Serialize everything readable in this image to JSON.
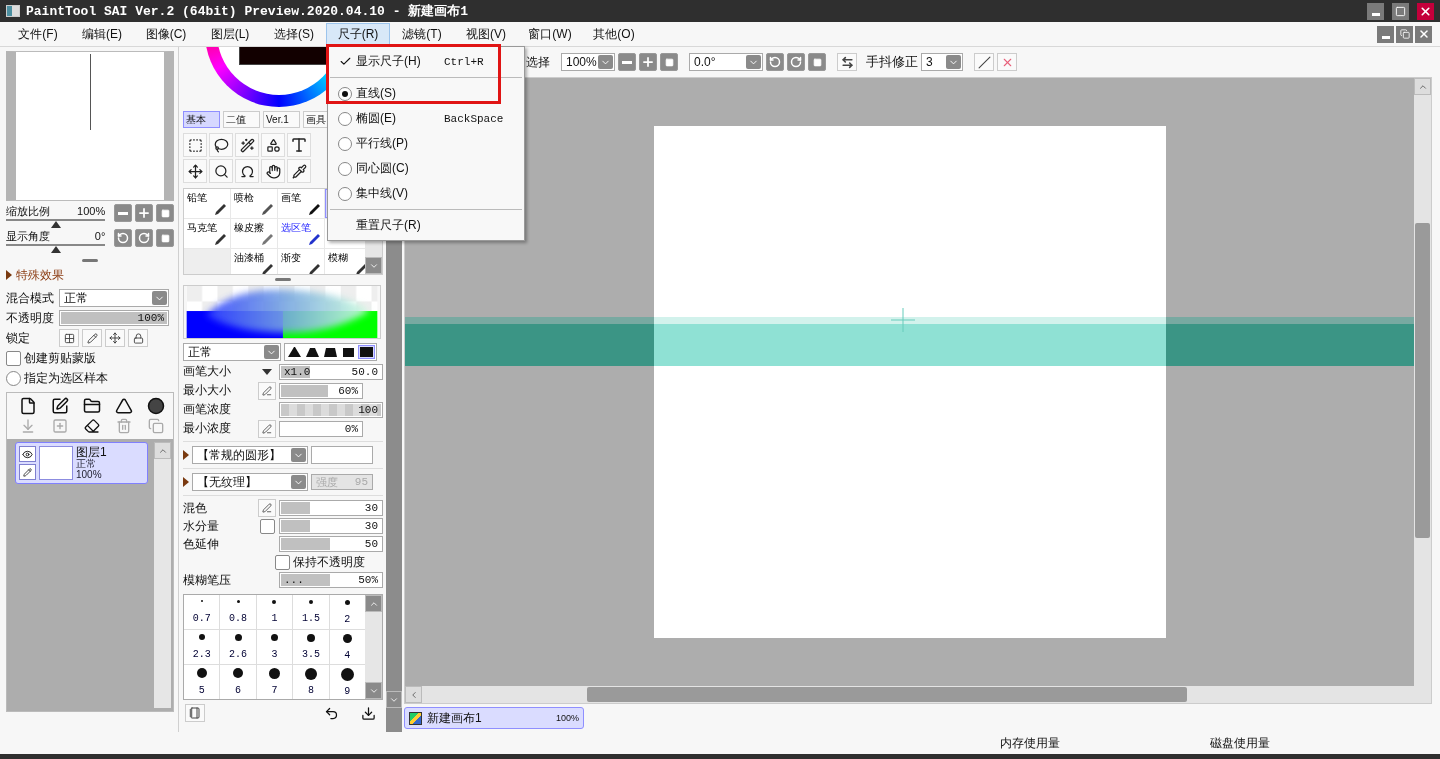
{
  "window": {
    "title": "PaintTool SAI Ver.2 (64bit) Preview.2020.04.10 - 新建画布1"
  },
  "menu": [
    {
      "label": "文件(F)",
      "selected": false
    },
    {
      "label": "编辑(E)",
      "selected": false
    },
    {
      "label": "图像(C)",
      "selected": false
    },
    {
      "label": "图层(L)",
      "selected": false
    },
    {
      "label": "选择(S)",
      "selected": false
    },
    {
      "label": "尺子(R)",
      "selected": true
    },
    {
      "label": "滤镜(T)",
      "selected": false
    },
    {
      "label": "视图(V)",
      "selected": false
    },
    {
      "label": "窗口(W)",
      "selected": false
    },
    {
      "label": "其他(O)",
      "selected": false
    }
  ],
  "ruler_menu": [
    {
      "kind": "check",
      "label": "显示尺子(H)",
      "shortcut": "Ctrl+R",
      "checked": true
    },
    {
      "kind": "separator"
    },
    {
      "kind": "radio",
      "label": "直线(S)",
      "selected": true
    },
    {
      "kind": "radio",
      "label": "椭圆(E)",
      "shortcut": "BackSpace",
      "selected": false
    },
    {
      "kind": "radio",
      "label": "平行线(P)",
      "selected": false
    },
    {
      "kind": "radio",
      "label": "同心圆(C)",
      "selected": false
    },
    {
      "kind": "radio",
      "label": "集中线(V)",
      "selected": false
    },
    {
      "kind": "separator"
    },
    {
      "kind": "command",
      "label": "重置尺子(R)"
    }
  ],
  "navigator": {
    "zoom": {
      "label": "缩放比例",
      "value": "100%",
      "level": 0.5
    },
    "angle": {
      "label": "显示角度",
      "value": "0°",
      "level": 0.5
    }
  },
  "effects": {
    "title": "特殊效果",
    "expanded": false
  },
  "layer_props": {
    "blend": {
      "label": "混合模式",
      "value": "正常"
    },
    "opacity": {
      "label": "不透明度",
      "value": "100%",
      "level": 1
    },
    "lock_label": "锁定",
    "clipping": {
      "label": "创建剪贴蒙版",
      "checked": false
    },
    "selection_source": {
      "label": "指定为选区样本",
      "selected": false
    }
  },
  "layers": [
    {
      "name": "图层1",
      "mode": "正常",
      "opacity": "100%",
      "selected": true
    }
  ],
  "color_tabs": [
    {
      "label": "基本",
      "selected": true
    },
    {
      "label": "二值",
      "selected": false
    },
    {
      "label": "Ver.1",
      "selected": false
    },
    {
      "label": "画具",
      "selected": false
    }
  ],
  "brush_tools": [
    {
      "kind": "tool",
      "label": "铅笔",
      "selected": false
    },
    {
      "kind": "tool",
      "label": "喷枪",
      "selected": false
    },
    {
      "kind": "tool",
      "label": "画笔",
      "selected": false
    },
    {
      "kind": "tool",
      "selected": true
    },
    {
      "kind": "tool",
      "label": "马克笔",
      "selected": false
    },
    {
      "kind": "tool",
      "label": "橡皮擦",
      "selected": false
    },
    {
      "kind": "selection_tool",
      "label": "选区笔",
      "selected": false
    },
    {
      "kind": "selection_tool",
      "selected": false
    },
    {
      "kind": "empty"
    },
    {
      "kind": "tool",
      "label": "油漆桶",
      "selected": false
    },
    {
      "kind": "tool",
      "label": "渐变",
      "selected": false
    },
    {
      "kind": "tool",
      "label": "模糊",
      "selected": false
    }
  ],
  "brush": {
    "blend": "正常",
    "shapes": [
      {
        "selected": false
      },
      {
        "selected": false
      },
      {
        "selected": false
      },
      {
        "selected": false
      },
      {
        "selected": true
      }
    ],
    "params": [
      {
        "label": "画笔大小",
        "prefix": "x1.0",
        "value": "50.0",
        "level": 0.3,
        "kind": "size"
      },
      {
        "label": "最小大小",
        "value": "60%",
        "level": 0.6,
        "kind": "pressure"
      },
      {
        "label": "画笔浓度",
        "value": "100",
        "level": 1,
        "kind": "density"
      },
      {
        "label": "最小浓度",
        "value": "0%",
        "kind": "pressure"
      }
    ],
    "shape": "【常规的圆形】",
    "texture": "【无纹理】",
    "texture_strength": {
      "label": "强度",
      "value": "95",
      "disabled": true
    },
    "mix": [
      {
        "label": "混色",
        "value": "30",
        "level": 0.3,
        "kind": "pressure"
      },
      {
        "label": "水分量",
        "value": "30",
        "level": 0.3,
        "kind": "check",
        "checked": false
      },
      {
        "label": "色延伸",
        "value": "50",
        "level": 0.5,
        "kind": "plain"
      },
      {
        "label": "保持不透明度",
        "checked": false,
        "kind": "checkbox"
      },
      {
        "label": "模糊笔压",
        "prefix": "...",
        "value": "50%",
        "level": 0.5,
        "kind": "plain"
      }
    ],
    "sizes": [
      "0.7",
      "0.8",
      "1",
      "1.5",
      "2",
      "2.3",
      "2.6",
      "3",
      "3.5",
      "4",
      "5",
      "6",
      "7",
      "8",
      "9"
    ]
  },
  "toolbar": {
    "label": "选择",
    "zoom": "100%",
    "angle": "0.0°",
    "stabilizer_label": "手抖修正",
    "stabilizer": "3"
  },
  "canvas_tabs": [
    {
      "name": "新建画布1",
      "zoom": "100%",
      "selected": true
    }
  ],
  "status_bar": [
    {
      "label": "内存使用量"
    },
    {
      "label": "磁盘使用量"
    }
  ]
}
